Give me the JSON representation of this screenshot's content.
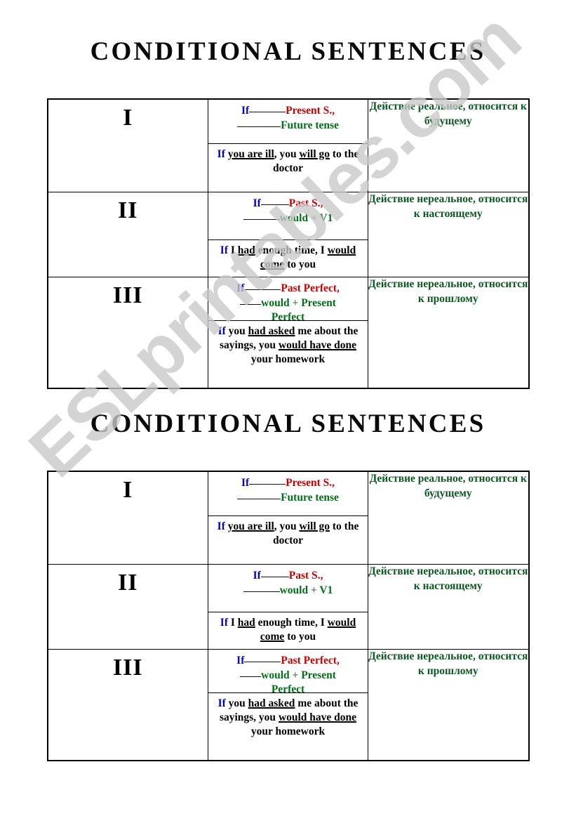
{
  "page": {
    "title": "CONDITIONAL SENTENCES",
    "watermark": "ESLprintables.com",
    "colors": {
      "conjunction": "#0000CC",
      "if_clause_tense": "#CC0000",
      "main_clause_tense": "#007018",
      "description": "#0b5a22",
      "border": "#000000",
      "watermark": "#c9c9c9"
    }
  },
  "blocks": [
    {
      "title": "CONDITIONAL SENTENCES"
    },
    {
      "title": "CONDITIONAL SENTENCES"
    }
  ],
  "table": {
    "rows": [
      {
        "numeral": "I",
        "formula": {
          "line1": {
            "if": "If",
            "blank": "_____",
            "tense": "Present S.",
            "comma": ","
          },
          "line2": {
            "blank": "________",
            "tense": "Future tense"
          }
        },
        "example": {
          "if": "If",
          "parts": "you are ill, you will go to the doctor",
          "line1_plain_a": " ",
          "underlined_1": "you are ill",
          "plain_1": ", you ",
          "underlined_2": "will go",
          "plain_2": " to the doctor"
        },
        "description": "Действие реальное, относится к будущему"
      },
      {
        "numeral": "II",
        "formula": {
          "line1": {
            "if": "If",
            "blank": "____",
            "tense": "Past S.",
            "comma": ","
          },
          "line2": {
            "blank": "______",
            "tense": "would",
            "plus": " + ",
            "tense2": "V1"
          }
        },
        "example": {
          "if": "If",
          "plain_0": " I ",
          "underlined_1": "had",
          "plain_1": " enough time, I ",
          "underlined_2": "would come",
          "plain_2": " to you"
        },
        "description": "Действие нереальное, относится к настоящему"
      },
      {
        "numeral": "III",
        "formula": {
          "line1": {
            "if": "If",
            "blank": "_____",
            "tense": "Past Perfect",
            "comma": ","
          },
          "line2": {
            "blank": "___",
            "tense": "would",
            "plus": " + ",
            "tense2": "Present"
          },
          "line3": {
            "tense": "Perfect"
          }
        },
        "example": {
          "if": "If",
          "plain_0": " you ",
          "underlined_1": "had asked",
          "plain_1": " me about the sayings, you ",
          "underlined_2": "would have done",
          "plain_2": " your homework"
        },
        "description": "Действие нереальное, относится к прошлому"
      }
    ]
  }
}
